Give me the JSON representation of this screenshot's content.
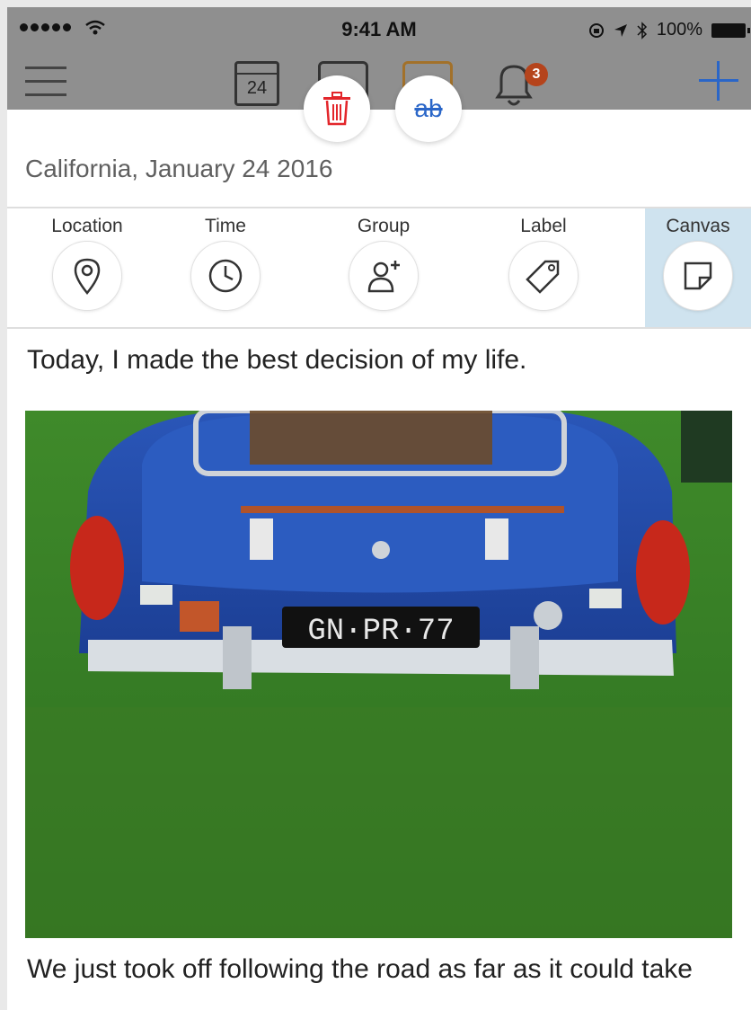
{
  "status_bar": {
    "time": "9:41 AM",
    "battery": "100%"
  },
  "nav": {
    "calendar_day": "24",
    "notification_count": "3",
    "icons": [
      "menu-icon",
      "calendar-icon",
      "note-icon",
      "note-icon",
      "bell-icon",
      "plus-icon"
    ],
    "accent": "#2a66c8"
  },
  "floating": {
    "strike_label": "ab",
    "delete_color": "#e3262b"
  },
  "entry": {
    "date_title": "California, January 24 2016",
    "paragraph_1": "Today, I made the best decision of my life.",
    "paragraph_2": "We just took off following the road as far as it could take",
    "photo_plate": "GN·PR·77"
  },
  "tools": [
    {
      "label": "Location",
      "icon": "location-pin-icon"
    },
    {
      "label": "Time",
      "icon": "clock-icon"
    },
    {
      "label": "Group",
      "icon": "add-person-icon"
    },
    {
      "label": "Label",
      "icon": "tag-icon"
    },
    {
      "label": "Canvas",
      "icon": "canvas-icon",
      "active": true
    }
  ]
}
